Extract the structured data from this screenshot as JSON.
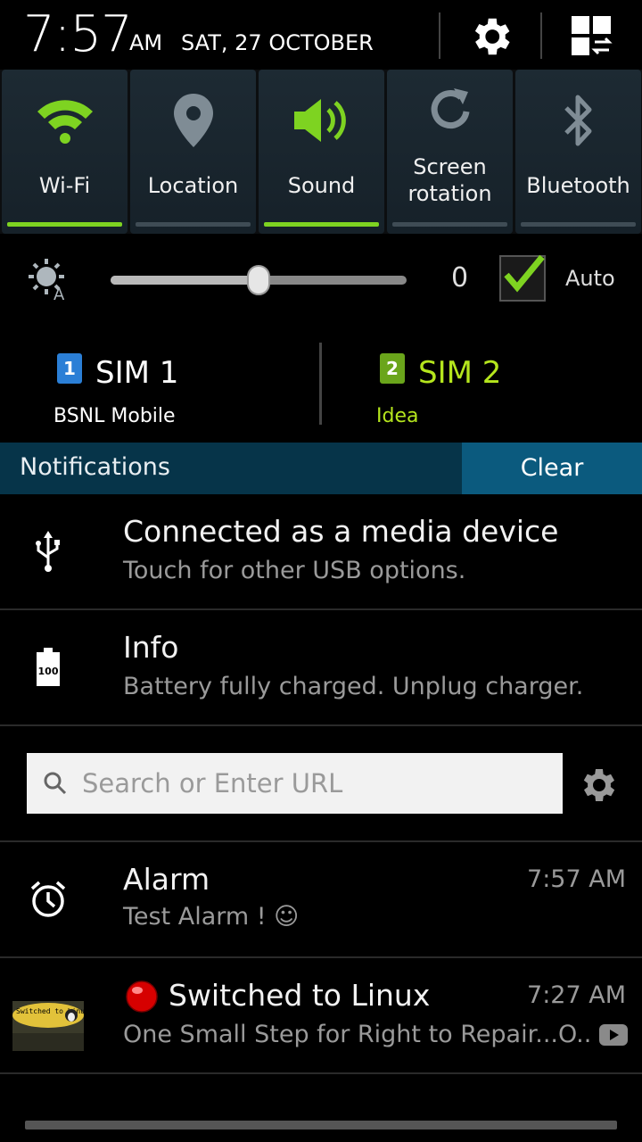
{
  "status": {
    "time": "7:57",
    "ampm": "AM",
    "date": "SAT, 27 OCTOBER"
  },
  "quick_toggles": [
    {
      "label": "Wi-Fi",
      "icon": "wifi-icon",
      "on": true
    },
    {
      "label": "Location",
      "icon": "location-pin-icon",
      "on": false
    },
    {
      "label": "Sound",
      "icon": "speaker-icon",
      "on": true
    },
    {
      "label": "Screen\nrotation",
      "icon": "rotation-icon",
      "on": false
    },
    {
      "label": "Bluetooth",
      "icon": "bluetooth-icon",
      "on": false
    }
  ],
  "brightness": {
    "value_text": "0",
    "level": 0.5,
    "auto_label": "Auto",
    "auto_checked": true
  },
  "sims": [
    {
      "badge": "1",
      "name": "SIM 1",
      "carrier": "BSNL Mobile",
      "color": "#ffffff",
      "badge_color": "#2b7fd6"
    },
    {
      "badge": "2",
      "name": "SIM 2",
      "carrier": "Idea",
      "color": "#b5e61d",
      "badge_color": "#6aa51b"
    }
  ],
  "notifications_header": {
    "title": "Notifications",
    "clear_label": "Clear"
  },
  "notifications": {
    "usb": {
      "title": "Connected as a media device",
      "text": "Touch for other USB options."
    },
    "info": {
      "title": "Info",
      "text": "Battery fully charged. Unplug charger.",
      "battery_value": "100"
    },
    "search": {
      "placeholder": "Search or Enter URL"
    },
    "alarm": {
      "title": "Alarm",
      "text": "Test Alarm ! ☺",
      "time": "7:57 AM"
    },
    "youtube": {
      "title": "Switched to Linux",
      "text": "One Small Step for Right to Repair...O..",
      "time": "7:27 AM",
      "thumb_text": "Switched to Linux"
    }
  },
  "colors": {
    "accent_green": "#7ed321",
    "notif_header_bg": "#063449",
    "clear_bg": "#0b5a7e"
  }
}
